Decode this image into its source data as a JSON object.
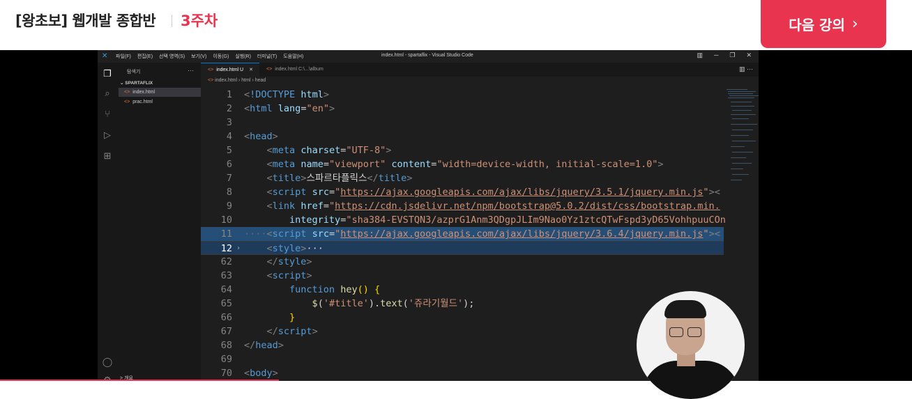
{
  "header": {
    "course_title": "[왕초보] 웹개발 종합반",
    "week_label": "3주차",
    "next_button_label": "다음 강의",
    "next_button_icon": "chevron-right-icon"
  },
  "colors": {
    "accent": "#e8344e",
    "editor_bg": "#1e1e1e"
  },
  "vscode": {
    "menu": [
      "파일(F)",
      "편집(E)",
      "선택 영역(S)",
      "보기(V)",
      "이동(G)",
      "실행(R)",
      "터미널(T)",
      "도움말(H)"
    ],
    "window_title": "index.html - spartaflix - Visual Studio Code",
    "explorer_title": "탐색기",
    "folder_name": "SPARTAFLIX",
    "files": [
      "index.html",
      "prac.html"
    ],
    "sidebar_footer": "> 개요",
    "tabs": [
      {
        "label": "index.html",
        "modified": "U"
      },
      {
        "label": "index.html",
        "path": "C:\\...\\album"
      }
    ],
    "breadcrumb": [
      "index.html",
      "html",
      "head"
    ]
  },
  "code_lines": [
    {
      "n": "1"
    },
    {
      "n": "2"
    },
    {
      "n": "3"
    },
    {
      "n": "4"
    },
    {
      "n": "5"
    },
    {
      "n": "6"
    },
    {
      "n": "7"
    },
    {
      "n": "8"
    },
    {
      "n": "9"
    },
    {
      "n": "10"
    },
    {
      "n": "11"
    },
    {
      "n": "12"
    },
    {
      "n": "62"
    },
    {
      "n": "63"
    },
    {
      "n": "64"
    },
    {
      "n": "65"
    },
    {
      "n": "66"
    },
    {
      "n": "67"
    },
    {
      "n": "68"
    },
    {
      "n": "69"
    },
    {
      "n": "70"
    }
  ]
}
